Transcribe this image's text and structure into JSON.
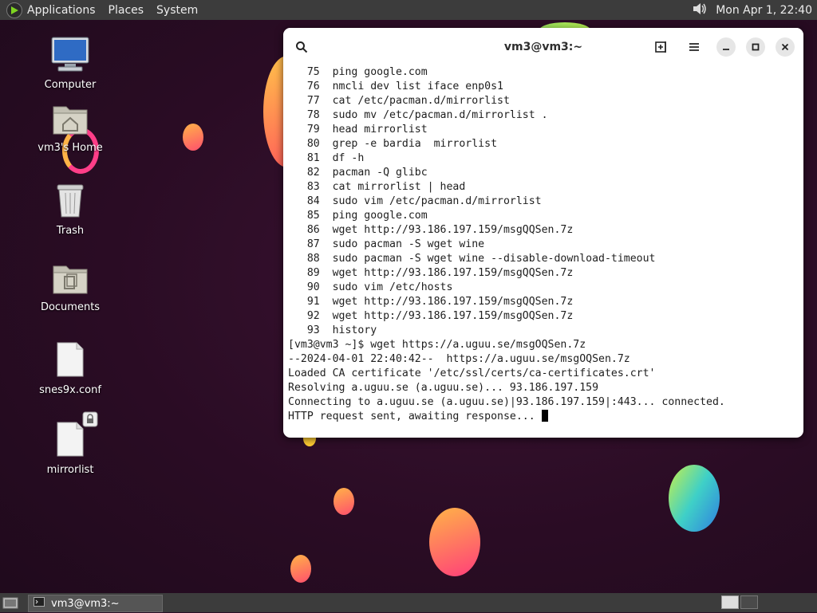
{
  "top_panel": {
    "applications": "Applications",
    "places": "Places",
    "system": "System",
    "clock": "Mon Apr 1, 22:40"
  },
  "desktop": {
    "icons": [
      {
        "label": "Computer"
      },
      {
        "label": "vm3's Home"
      },
      {
        "label": "Trash"
      },
      {
        "label": "Documents"
      },
      {
        "label": "snes9x.conf"
      },
      {
        "label": "mirrorlist"
      }
    ]
  },
  "terminal": {
    "title": "vm3@vm3:~",
    "lines": [
      "   75  ping google.com",
      "   76  nmcli dev list iface enp0s1",
      "   77  cat /etc/pacman.d/mirrorlist",
      "   78  sudo mv /etc/pacman.d/mirrorlist .",
      "   79  head mirrorlist",
      "   80  grep -e bardia  mirrorlist",
      "   81  df -h",
      "   82  pacman -Q glibc",
      "   83  cat mirrorlist | head",
      "   84  sudo vim /etc/pacman.d/mirrorlist",
      "   85  ping google.com",
      "   86  wget http://93.186.197.159/msgQQSen.7z",
      "   87  sudo pacman -S wget wine",
      "   88  sudo pacman -S wget wine --disable-download-timeout",
      "   89  wget http://93.186.197.159/msgQQSen.7z",
      "   90  sudo vim /etc/hosts",
      "   91  wget http://93.186.197.159/msgQQSen.7z",
      "   92  wget http://93.186.197.159/msgOQSen.7z",
      "   93  history",
      "[vm3@vm3 ~]$ wget https://a.uguu.se/msgOQSen.7z",
      "--2024-04-01 22:40:42--  https://a.uguu.se/msgOQSen.7z",
      "Loaded CA certificate '/etc/ssl/certs/ca-certificates.crt'",
      "Resolving a.uguu.se (a.uguu.se)... 93.186.197.159",
      "Connecting to a.uguu.se (a.uguu.se)|93.186.197.159|:443... connected.",
      "HTTP request sent, awaiting response... "
    ]
  },
  "bottom_panel": {
    "task_label": "vm3@vm3:~"
  }
}
